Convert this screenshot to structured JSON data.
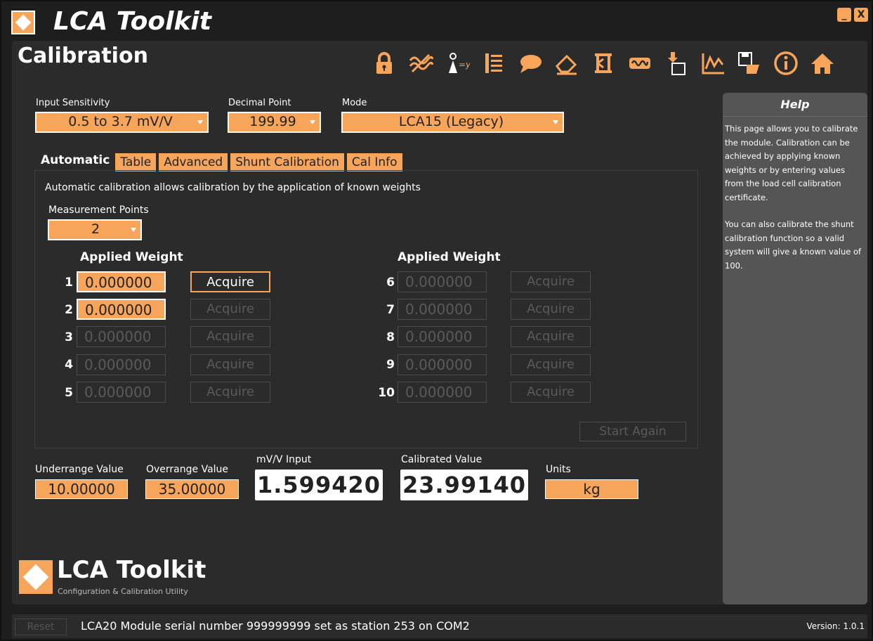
{
  "app": {
    "title": "LCA Toolkit",
    "minimize": "_",
    "close": "X"
  },
  "page": {
    "title": "Calibration"
  },
  "toolbar": {
    "icons": [
      "lock-icon",
      "filter-icon",
      "formula-icon",
      "list-icon",
      "chat-icon",
      "eraser-icon",
      "sigma-icon",
      "signal-icon",
      "import-icon",
      "chart-icon",
      "save-icon",
      "info-icon",
      "home-icon"
    ]
  },
  "settings": {
    "input_sensitivity_label": "Input Sensitivity",
    "input_sensitivity_value": "0.5 to 3.7 mV/V",
    "decimal_point_label": "Decimal Point",
    "decimal_point_value": "199.99",
    "mode_label": "Mode",
    "mode_value": "LCA15 (Legacy)"
  },
  "tabs": [
    "Automatic",
    "Table",
    "Advanced",
    "Shunt Calibration",
    "Cal Info"
  ],
  "automatic": {
    "description": "Automatic calibration allows calibration by the application of known weights",
    "measurement_points_label": "Measurement Points",
    "measurement_points_value": "2",
    "applied_weight_header": "Applied Weight",
    "acquire_label": "Acquire",
    "start_again_label": "Start Again",
    "rows": [
      {
        "num": "1",
        "value": "0.000000"
      },
      {
        "num": "2",
        "value": "0.000000"
      },
      {
        "num": "3",
        "value": "0.000000"
      },
      {
        "num": "4",
        "value": "0.000000"
      },
      {
        "num": "5",
        "value": "0.000000"
      },
      {
        "num": "6",
        "value": "0.000000"
      },
      {
        "num": "7",
        "value": "0.000000"
      },
      {
        "num": "8",
        "value": "0.000000"
      },
      {
        "num": "9",
        "value": "0.000000"
      },
      {
        "num": "10",
        "value": "0.000000"
      }
    ]
  },
  "readings": {
    "underrange_label": "Underrange Value",
    "underrange_value": "10.00000",
    "overrange_label": "Overrange Value",
    "overrange_value": "35.00000",
    "mvv_label": "mV/V Input",
    "mvv_value": "1.599420",
    "calibrated_label": "Calibrated Value",
    "calibrated_value": "23.99140",
    "units_label": "Units",
    "units_value": "kg"
  },
  "brand": {
    "name": "LCA Toolkit",
    "subtitle": "Configuration & Calibration Utility"
  },
  "help": {
    "title": "Help",
    "para1": "This page allows you to calibrate the module. Calibration can be achieved by applying known weights or by entering values from the load cell calibration certificate.",
    "para2": "You can also calibrate the shunt calibration function so a valid system will give a known value of 100."
  },
  "status": {
    "reset_label": "Reset",
    "message": "LCA20 Module serial number 999999999 set as station 253 on COM2",
    "version": "Version: 1.0.1"
  },
  "colors": {
    "accent": "#f7a55a",
    "background": "#2b2b2b",
    "help_panel": "#555555"
  }
}
